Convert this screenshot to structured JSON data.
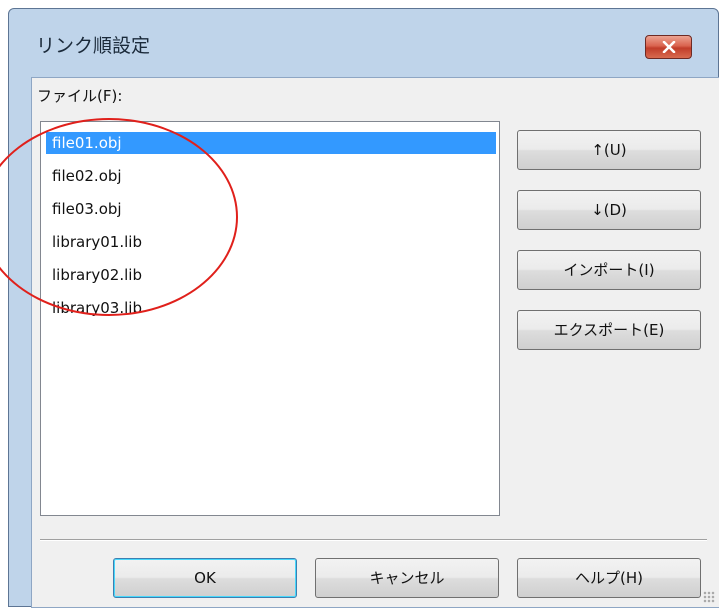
{
  "dialog": {
    "title": "リンク順設定",
    "close_icon": "close-x-icon",
    "accent_color": "#c13d2a"
  },
  "file_label": "ファイル(F):",
  "files": [
    {
      "name": "file01.obj",
      "selected": true
    },
    {
      "name": "file02.obj",
      "selected": false
    },
    {
      "name": "file03.obj",
      "selected": false
    },
    {
      "name": "library01.lib",
      "selected": false
    },
    {
      "name": "library02.lib",
      "selected": false
    },
    {
      "name": "library03.lib",
      "selected": false
    }
  ],
  "side_buttons": {
    "up": "↑(U)",
    "down": "↓(D)",
    "import": "インポート(I)",
    "export": "エクスポート(E)"
  },
  "bottom_buttons": {
    "ok": "OK",
    "cancel": "キャンセル",
    "help": "ヘルプ(H)"
  },
  "annotation": {
    "shape": "red-circle",
    "color": "#e0201b"
  }
}
